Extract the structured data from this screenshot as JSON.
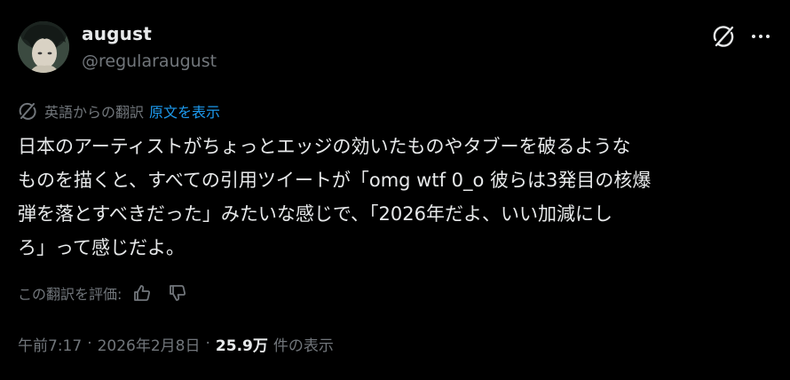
{
  "author": {
    "display_name": "august",
    "handle": "@regularaugust",
    "avatar": "anime-character-avatar"
  },
  "header_actions": {
    "grok_icon": "grok-slash-circle-icon",
    "more_icon": "more-horizontal-icon"
  },
  "translation": {
    "icon": "translate-slash-icon",
    "translated_from": "英語からの翻訳",
    "show_original": "原文を表示"
  },
  "tweet": {
    "lines": [
      "日本のアーティストがちょっとエッジの効いたものやタブーを破るような",
      "ものを描くと、すべての引用ツイートが「omg wtf 0_o 彼らは3発目の核爆",
      "弾を落とすべきだった」みたいな感じで、「2026年だよ、いい加減にし",
      "ろ」って感じだよ。"
    ]
  },
  "rating": {
    "label": "この翻訳を評価:",
    "thumbs_up_icon": "thumbs-up-icon",
    "thumbs_down_icon": "thumbs-down-icon"
  },
  "meta": {
    "time": "午前7:17",
    "separator": "·",
    "date": "2026年2月8日",
    "views_count": "25.9万",
    "views_label": "件の表示"
  },
  "colors": {
    "background": "#000000",
    "text_primary": "#e7e9ea",
    "text_secondary": "#71767b",
    "link": "#1d9bf0"
  }
}
